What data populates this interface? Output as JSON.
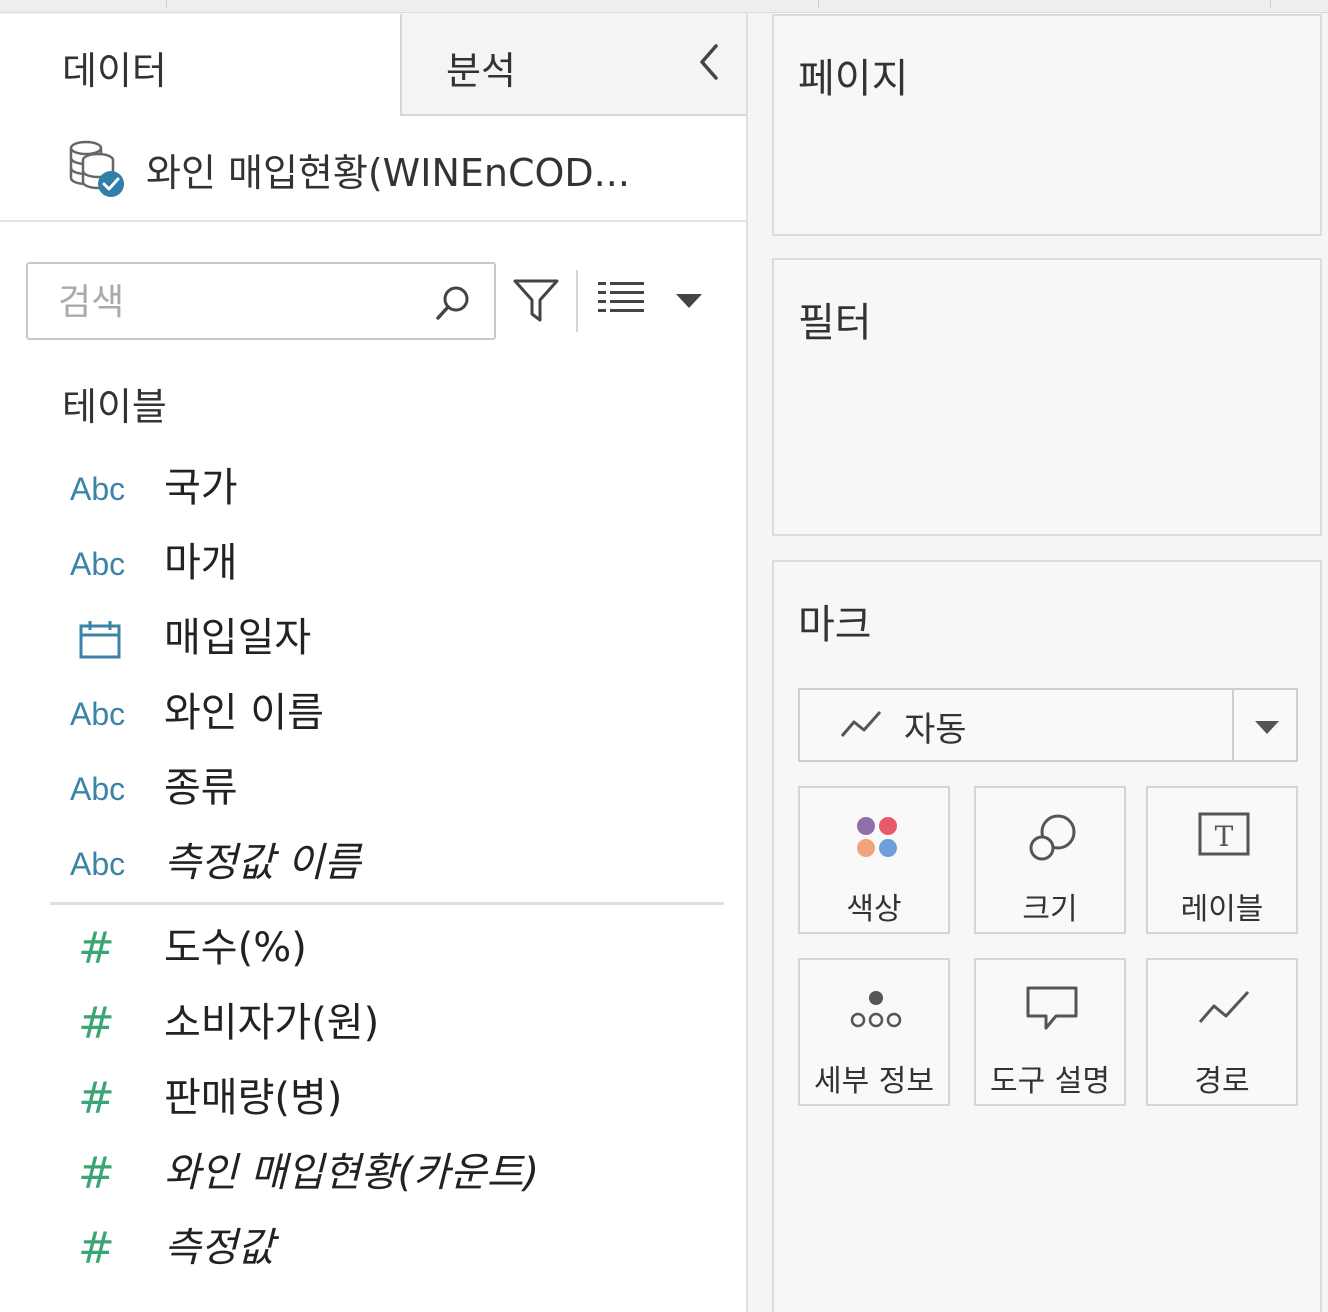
{
  "tabs": {
    "data_label": "데이터",
    "analysis_label": "분석"
  },
  "datasource": {
    "name": "와인 매입현황(WINEnCOD..."
  },
  "search": {
    "placeholder": "검색",
    "value": ""
  },
  "tables_section": {
    "title": "테이블"
  },
  "fields": {
    "dimensions": [
      {
        "type_icon": "Abc",
        "name": "국가",
        "italic": false
      },
      {
        "type_icon": "Abc",
        "name": "마개",
        "italic": false
      },
      {
        "type_icon": "calendar-icon",
        "name": "매입일자",
        "italic": false
      },
      {
        "type_icon": "Abc",
        "name": "와인 이름",
        "italic": false
      },
      {
        "type_icon": "Abc",
        "name": "종류",
        "italic": false
      },
      {
        "type_icon": "Abc",
        "name": "측정값 이름",
        "italic": true
      }
    ],
    "measures": [
      {
        "type_icon": "#",
        "name": "도수(%)",
        "italic": false
      },
      {
        "type_icon": "#",
        "name": "소비자가(원)",
        "italic": false
      },
      {
        "type_icon": "#",
        "name": "판매량(병)",
        "italic": false
      },
      {
        "type_icon": "#",
        "name": "와인 매입현황(카운트)",
        "italic": true
      },
      {
        "type_icon": "#",
        "name": "측정값",
        "italic": true
      }
    ]
  },
  "cards": {
    "pages_title": "페이지",
    "filters_title": "필터",
    "marks_title": "마크"
  },
  "marks": {
    "type_label": "자동",
    "buttons": {
      "color": "색상",
      "size": "크기",
      "label": "레이블",
      "detail": "세부 정보",
      "tooltip": "도구 설명",
      "path": "경로"
    }
  },
  "colors": {
    "dimension_icon": "#3b84a8",
    "measure_icon": "#3aa676",
    "datasource_badge": "#2f7fab",
    "color_dots": [
      "#8e6fa8",
      "#e8596b",
      "#f0a27a",
      "#6f9fd8"
    ]
  }
}
